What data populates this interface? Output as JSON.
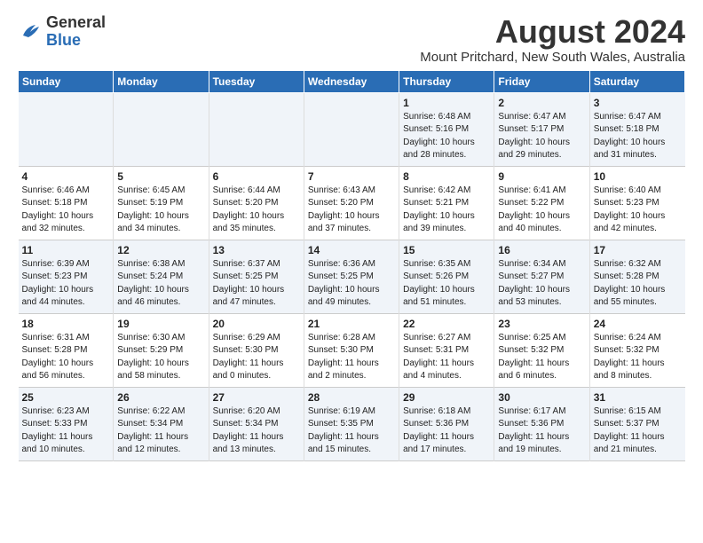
{
  "header": {
    "logo_general": "General",
    "logo_blue": "Blue",
    "month_title": "August 2024",
    "location": "Mount Pritchard, New South Wales, Australia"
  },
  "days_of_week": [
    "Sunday",
    "Monday",
    "Tuesday",
    "Wednesday",
    "Thursday",
    "Friday",
    "Saturday"
  ],
  "weeks": [
    [
      {
        "day": "",
        "info": ""
      },
      {
        "day": "",
        "info": ""
      },
      {
        "day": "",
        "info": ""
      },
      {
        "day": "",
        "info": ""
      },
      {
        "day": "1",
        "info": "Sunrise: 6:48 AM\nSunset: 5:16 PM\nDaylight: 10 hours\nand 28 minutes."
      },
      {
        "day": "2",
        "info": "Sunrise: 6:47 AM\nSunset: 5:17 PM\nDaylight: 10 hours\nand 29 minutes."
      },
      {
        "day": "3",
        "info": "Sunrise: 6:47 AM\nSunset: 5:18 PM\nDaylight: 10 hours\nand 31 minutes."
      }
    ],
    [
      {
        "day": "4",
        "info": "Sunrise: 6:46 AM\nSunset: 5:18 PM\nDaylight: 10 hours\nand 32 minutes."
      },
      {
        "day": "5",
        "info": "Sunrise: 6:45 AM\nSunset: 5:19 PM\nDaylight: 10 hours\nand 34 minutes."
      },
      {
        "day": "6",
        "info": "Sunrise: 6:44 AM\nSunset: 5:20 PM\nDaylight: 10 hours\nand 35 minutes."
      },
      {
        "day": "7",
        "info": "Sunrise: 6:43 AM\nSunset: 5:20 PM\nDaylight: 10 hours\nand 37 minutes."
      },
      {
        "day": "8",
        "info": "Sunrise: 6:42 AM\nSunset: 5:21 PM\nDaylight: 10 hours\nand 39 minutes."
      },
      {
        "day": "9",
        "info": "Sunrise: 6:41 AM\nSunset: 5:22 PM\nDaylight: 10 hours\nand 40 minutes."
      },
      {
        "day": "10",
        "info": "Sunrise: 6:40 AM\nSunset: 5:23 PM\nDaylight: 10 hours\nand 42 minutes."
      }
    ],
    [
      {
        "day": "11",
        "info": "Sunrise: 6:39 AM\nSunset: 5:23 PM\nDaylight: 10 hours\nand 44 minutes."
      },
      {
        "day": "12",
        "info": "Sunrise: 6:38 AM\nSunset: 5:24 PM\nDaylight: 10 hours\nand 46 minutes."
      },
      {
        "day": "13",
        "info": "Sunrise: 6:37 AM\nSunset: 5:25 PM\nDaylight: 10 hours\nand 47 minutes."
      },
      {
        "day": "14",
        "info": "Sunrise: 6:36 AM\nSunset: 5:25 PM\nDaylight: 10 hours\nand 49 minutes."
      },
      {
        "day": "15",
        "info": "Sunrise: 6:35 AM\nSunset: 5:26 PM\nDaylight: 10 hours\nand 51 minutes."
      },
      {
        "day": "16",
        "info": "Sunrise: 6:34 AM\nSunset: 5:27 PM\nDaylight: 10 hours\nand 53 minutes."
      },
      {
        "day": "17",
        "info": "Sunrise: 6:32 AM\nSunset: 5:28 PM\nDaylight: 10 hours\nand 55 minutes."
      }
    ],
    [
      {
        "day": "18",
        "info": "Sunrise: 6:31 AM\nSunset: 5:28 PM\nDaylight: 10 hours\nand 56 minutes."
      },
      {
        "day": "19",
        "info": "Sunrise: 6:30 AM\nSunset: 5:29 PM\nDaylight: 10 hours\nand 58 minutes."
      },
      {
        "day": "20",
        "info": "Sunrise: 6:29 AM\nSunset: 5:30 PM\nDaylight: 11 hours\nand 0 minutes."
      },
      {
        "day": "21",
        "info": "Sunrise: 6:28 AM\nSunset: 5:30 PM\nDaylight: 11 hours\nand 2 minutes."
      },
      {
        "day": "22",
        "info": "Sunrise: 6:27 AM\nSunset: 5:31 PM\nDaylight: 11 hours\nand 4 minutes."
      },
      {
        "day": "23",
        "info": "Sunrise: 6:25 AM\nSunset: 5:32 PM\nDaylight: 11 hours\nand 6 minutes."
      },
      {
        "day": "24",
        "info": "Sunrise: 6:24 AM\nSunset: 5:32 PM\nDaylight: 11 hours\nand 8 minutes."
      }
    ],
    [
      {
        "day": "25",
        "info": "Sunrise: 6:23 AM\nSunset: 5:33 PM\nDaylight: 11 hours\nand 10 minutes."
      },
      {
        "day": "26",
        "info": "Sunrise: 6:22 AM\nSunset: 5:34 PM\nDaylight: 11 hours\nand 12 minutes."
      },
      {
        "day": "27",
        "info": "Sunrise: 6:20 AM\nSunset: 5:34 PM\nDaylight: 11 hours\nand 13 minutes."
      },
      {
        "day": "28",
        "info": "Sunrise: 6:19 AM\nSunset: 5:35 PM\nDaylight: 11 hours\nand 15 minutes."
      },
      {
        "day": "29",
        "info": "Sunrise: 6:18 AM\nSunset: 5:36 PM\nDaylight: 11 hours\nand 17 minutes."
      },
      {
        "day": "30",
        "info": "Sunrise: 6:17 AM\nSunset: 5:36 PM\nDaylight: 11 hours\nand 19 minutes."
      },
      {
        "day": "31",
        "info": "Sunrise: 6:15 AM\nSunset: 5:37 PM\nDaylight: 11 hours\nand 21 minutes."
      }
    ]
  ]
}
